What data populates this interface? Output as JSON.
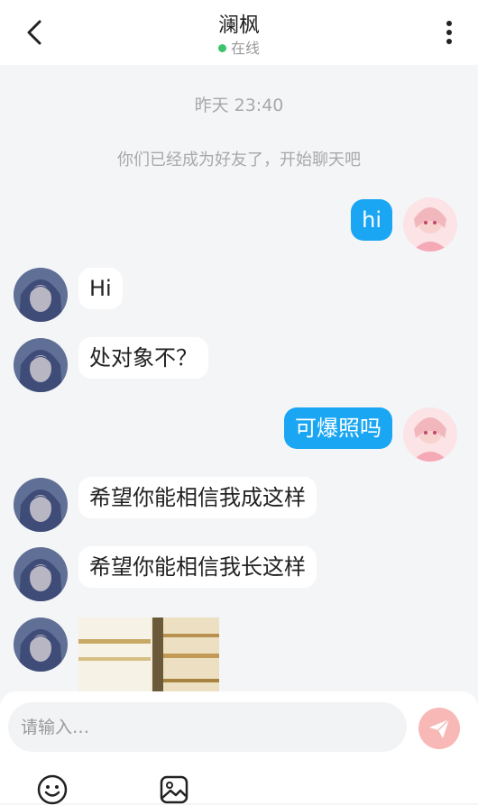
{
  "header": {
    "title": "澜枫",
    "status": "在线"
  },
  "chat": {
    "timestamp": "昨天 23:40",
    "system_notice": "你们已经成为好友了，开始聊天吧",
    "messages": [
      {
        "side": "out",
        "text": "hi"
      },
      {
        "side": "in",
        "text": "Hi"
      },
      {
        "side": "in",
        "text": "处对象不？"
      },
      {
        "side": "out",
        "text": "可爆照吗"
      },
      {
        "side": "in",
        "text": "希望你能相信我成这样"
      },
      {
        "side": "in",
        "text": "希望你能相信我长这样"
      }
    ]
  },
  "composer": {
    "placeholder": "请输入…"
  },
  "icons": {
    "back": "chevron-left-icon",
    "more": "more-vertical-icon",
    "send": "send-icon",
    "emoji": "emoji-icon",
    "image": "image-icon"
  },
  "colors": {
    "accent": "#1aa6f2",
    "online": "#3cc46a",
    "send_button": "#f7b8b6",
    "background": "#f4f5f7"
  }
}
